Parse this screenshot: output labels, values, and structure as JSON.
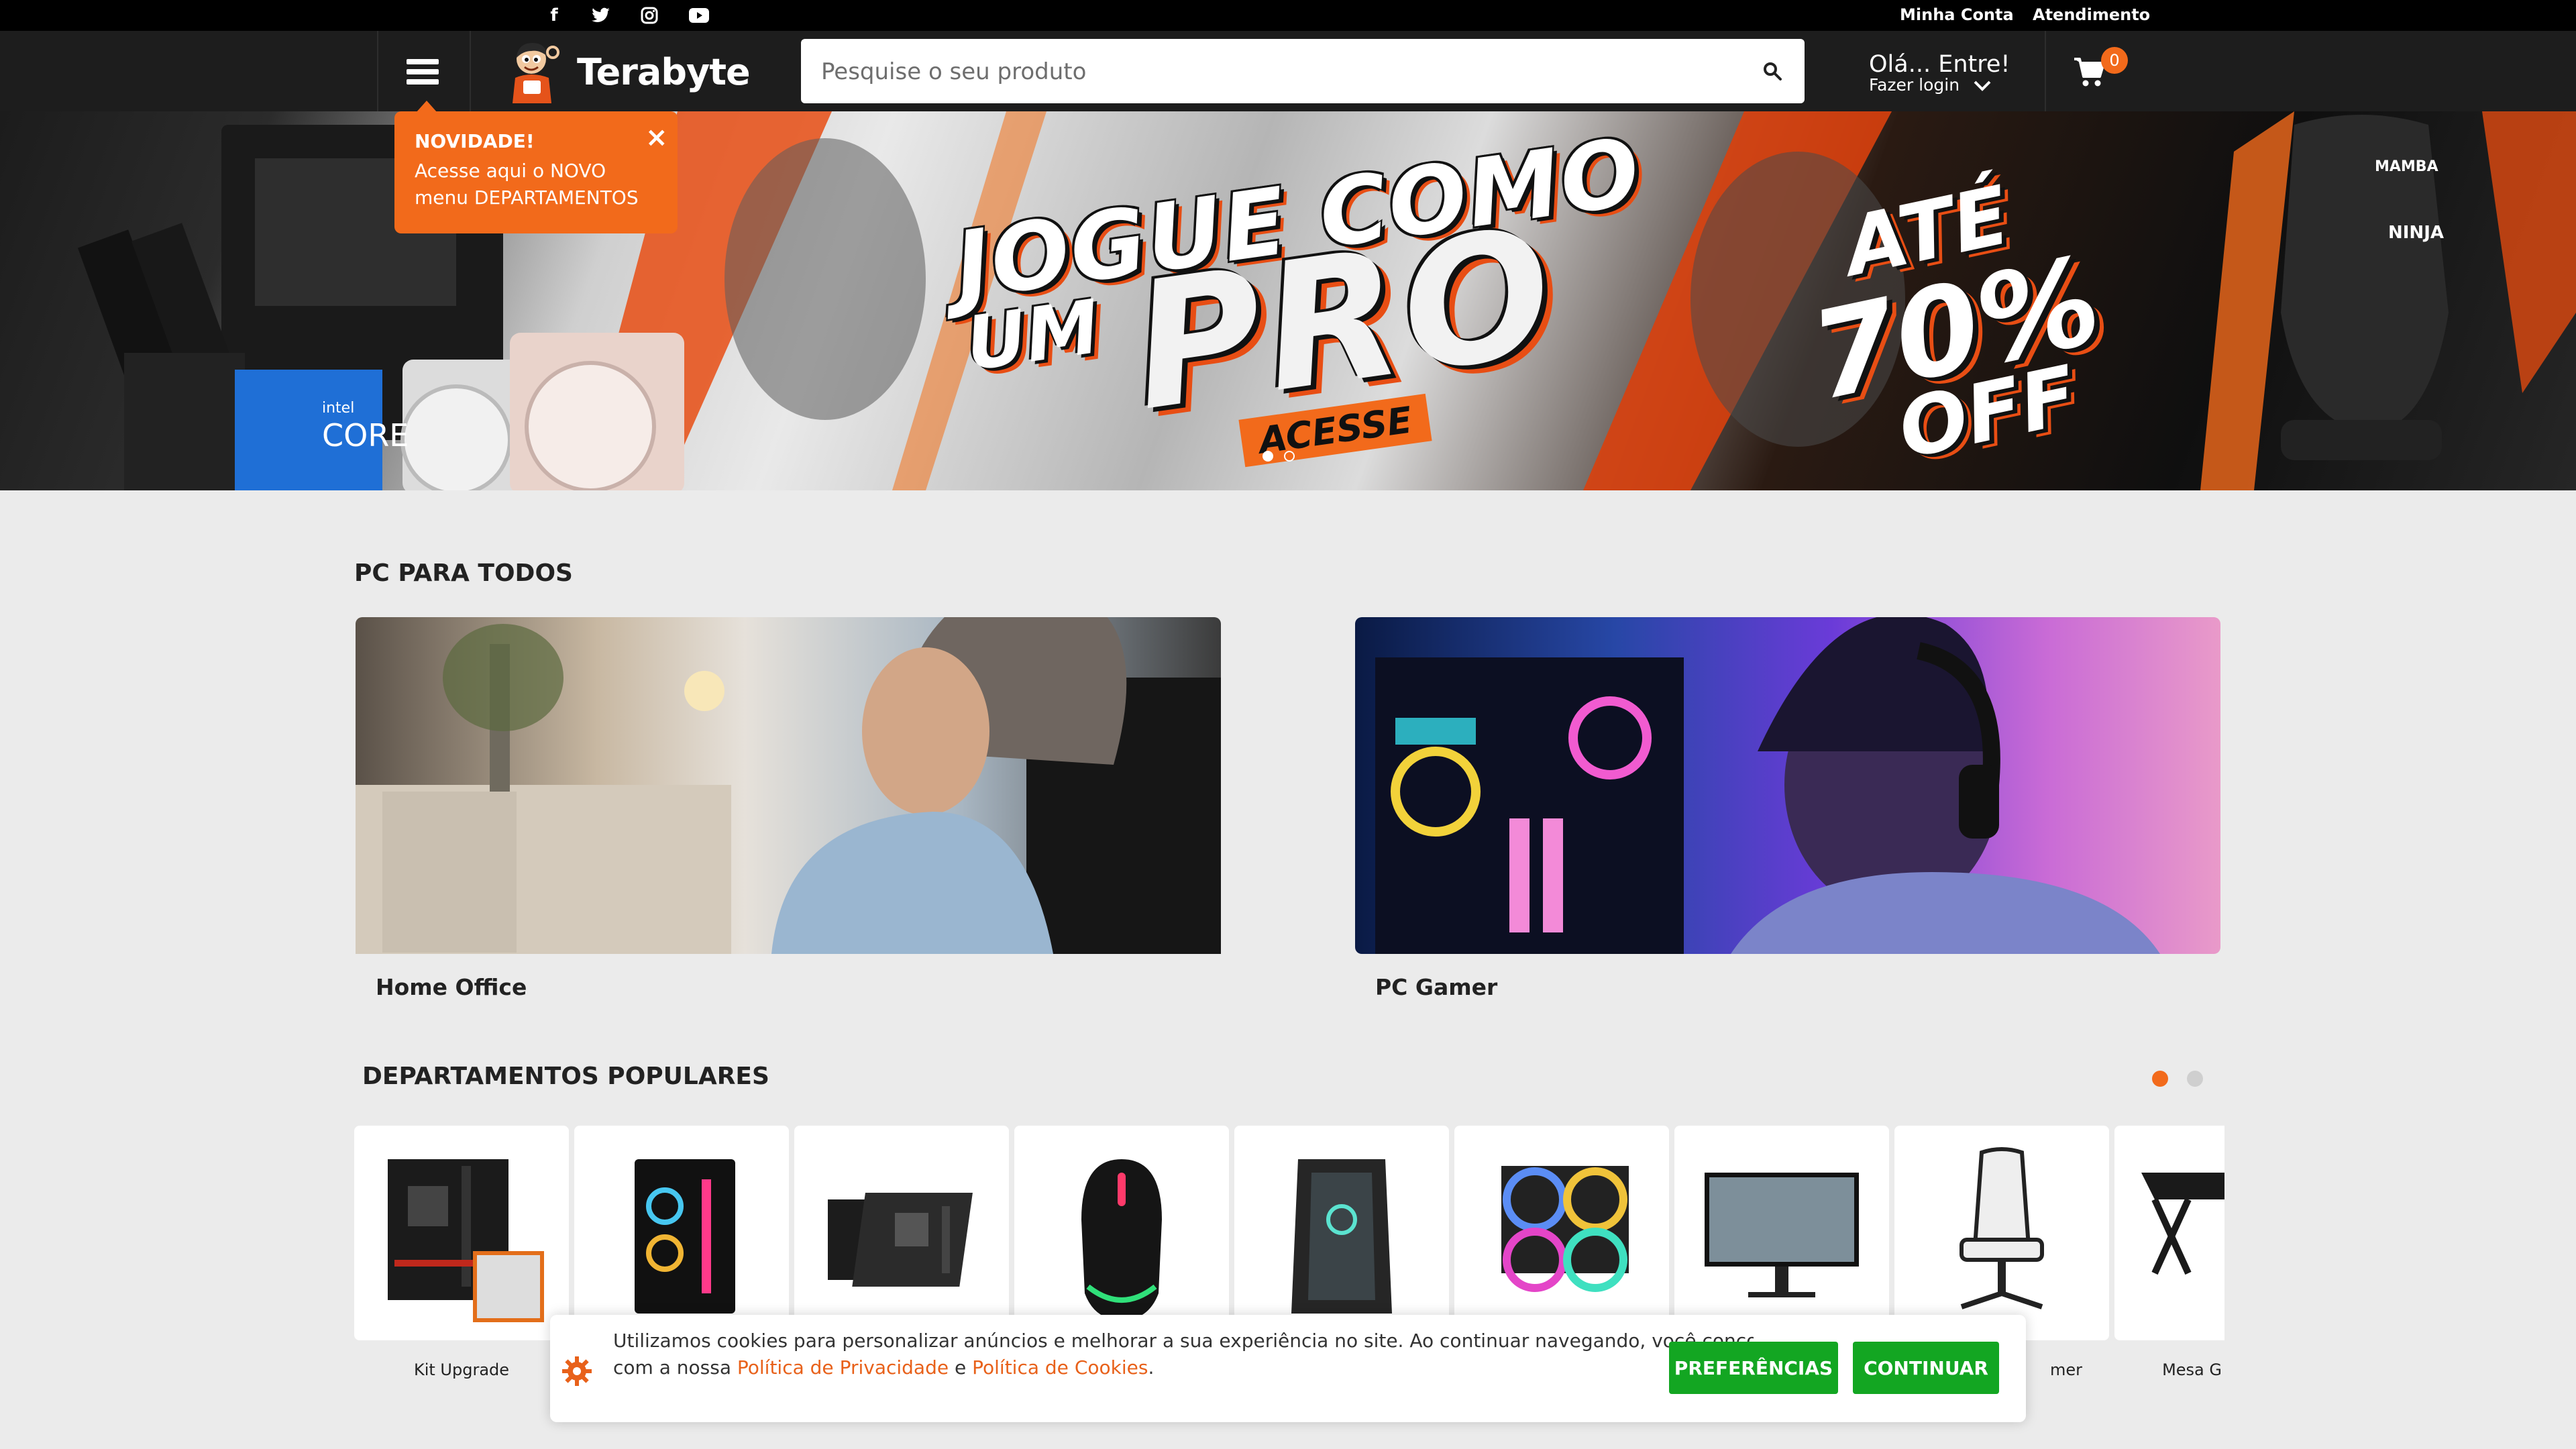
{
  "topbar": {
    "social": [
      {
        "name": "facebook-icon",
        "glyph": "f"
      },
      {
        "name": "twitter-icon",
        "glyph": "t"
      },
      {
        "name": "instagram-icon",
        "glyph": "◎"
      },
      {
        "name": "youtube-icon",
        "glyph": "▶"
      }
    ],
    "account_label": "Minha Conta",
    "support_label": "Atendimento"
  },
  "header": {
    "logo_text": "Terabyte",
    "search_placeholder": "Pesquise o seu produto",
    "greeting": "Olá... Entre!",
    "login_label": "Fazer login",
    "cart_count": "0"
  },
  "tooltip": {
    "title": "NOVIDADE!",
    "line1": "Acesse aqui o NOVO",
    "line2": "menu DEPARTAMENTOS",
    "close": "×"
  },
  "hero": {
    "line1": "JOGUE COMO",
    "line2_small": "UM",
    "line2_big": "PRO",
    "cta": "ACESSE",
    "offer1": "ATÉ",
    "offer2": "70%",
    "offer3": "OFF",
    "cpu_brand": "intel",
    "cpu_model": "CORE",
    "chair_brand1": "MAMBA",
    "chair_brand2": "NINJA"
  },
  "pc_section": {
    "title": "PC PARA TODOS",
    "cards": [
      {
        "label": "Home Office"
      },
      {
        "label": "PC Gamer"
      }
    ]
  },
  "departments": {
    "title": "DEPARTAMENTOS POPULARES",
    "items": [
      {
        "label": "Kit Upgrade",
        "icon": "kit-upgrade-icon"
      },
      {
        "label": "",
        "icon": "pc-case-icon"
      },
      {
        "label": "",
        "icon": "motherboard-icon"
      },
      {
        "label": "",
        "icon": "mouse-icon"
      },
      {
        "label": "",
        "icon": "gabinete-icon"
      },
      {
        "label": "",
        "icon": "water-cooler-icon"
      },
      {
        "label": "",
        "icon": "monitor-icon"
      },
      {
        "label": "mer",
        "icon": "gamer-chair-icon"
      },
      {
        "label": "Mesa G",
        "icon": "desk-icon"
      }
    ]
  },
  "cookie": {
    "text_line1": "Utilizamos cookies para personalizar anúncios e melhorar a sua experiência no site. Ao continuar navegando, você concorda",
    "text_line2_prefix": "com a nossa ",
    "privacy_link": "Política de Privacidade",
    "and": " e ",
    "cookie_link": "Política de Cookies",
    "suffix": ".",
    "prefs_button": "PREFERÊNCIAS",
    "continue_button": "CONTINUAR"
  },
  "colors": {
    "accent": "#f26a1b",
    "header_bg": "#1d1d1d",
    "topbar_bg": "#000000",
    "page_bg": "#ebebeb",
    "button_green": "#13a622"
  }
}
